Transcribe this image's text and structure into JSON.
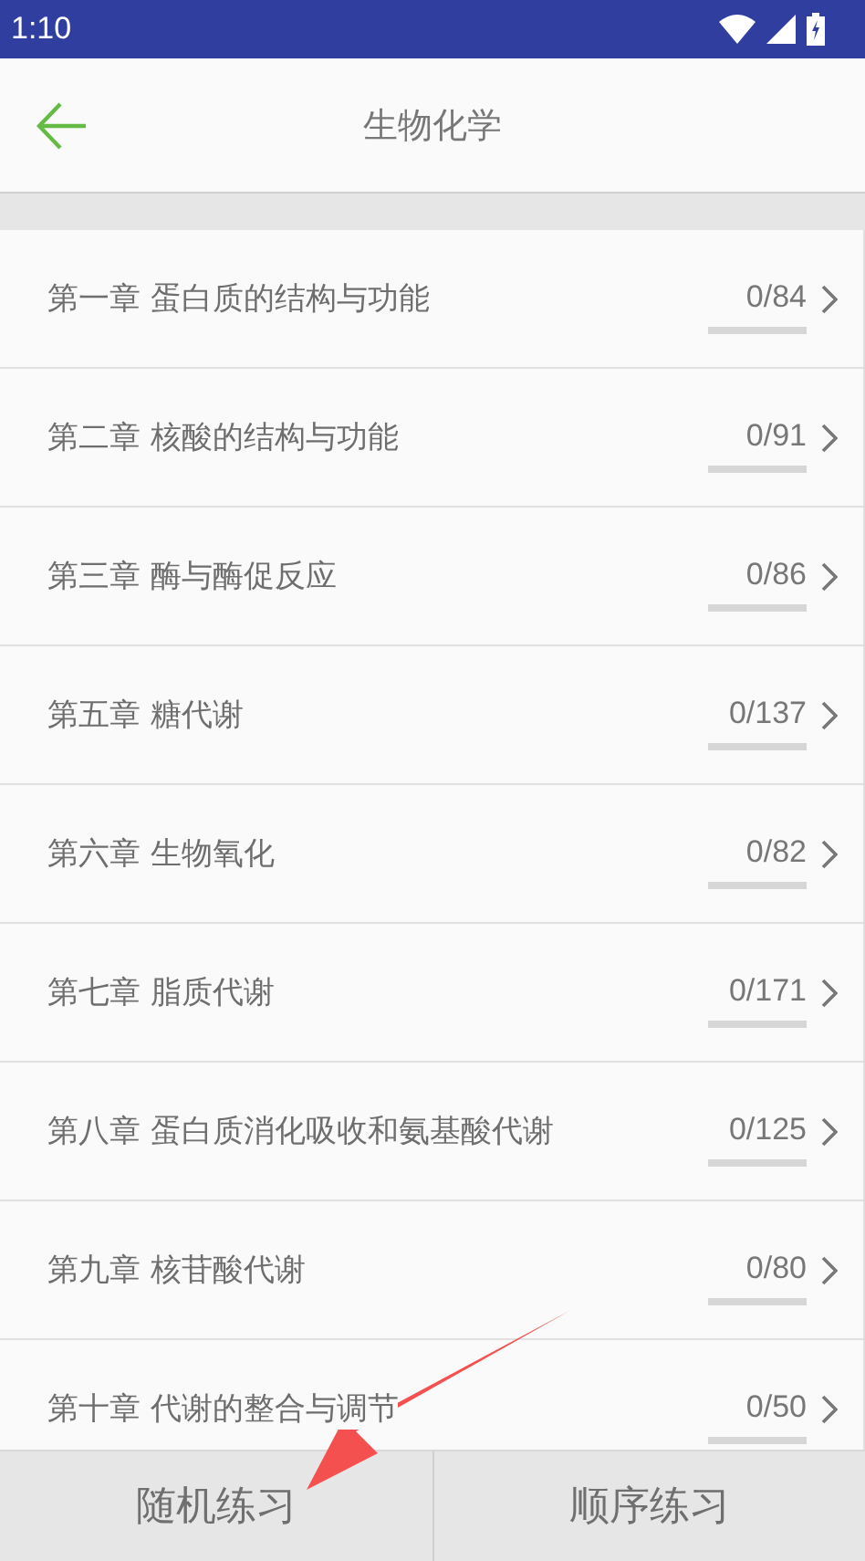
{
  "status_bar": {
    "time": "1:10"
  },
  "header": {
    "title": "生物化学"
  },
  "chapters": [
    {
      "title": "第一章 蛋白质的结构与功能",
      "count": "0/84",
      "level": 0
    },
    {
      "title": "第二章 核酸的结构与功能",
      "count": "0/91",
      "level": 0
    },
    {
      "title": "第三章 酶与酶促反应",
      "count": "0/86",
      "level": 0
    },
    {
      "title": "第五章 糖代谢",
      "count": "0/137",
      "level": 0
    },
    {
      "title": "第六章 生物氧化",
      "count": "0/82",
      "level": 0
    },
    {
      "title": "第七章 脂质代谢",
      "count": "0/171",
      "level": 0
    },
    {
      "title": "第八章 蛋白质消化吸收和氨基酸代谢",
      "count": "0/125",
      "level": 0
    },
    {
      "title": "第九章 核苷酸代谢",
      "count": "0/80",
      "level": 0
    },
    {
      "title": "第十章 代谢的整合与调节",
      "count": "0/50",
      "level": 0
    }
  ],
  "bottom_buttons": [
    "随机练习",
    "顺序练习"
  ]
}
